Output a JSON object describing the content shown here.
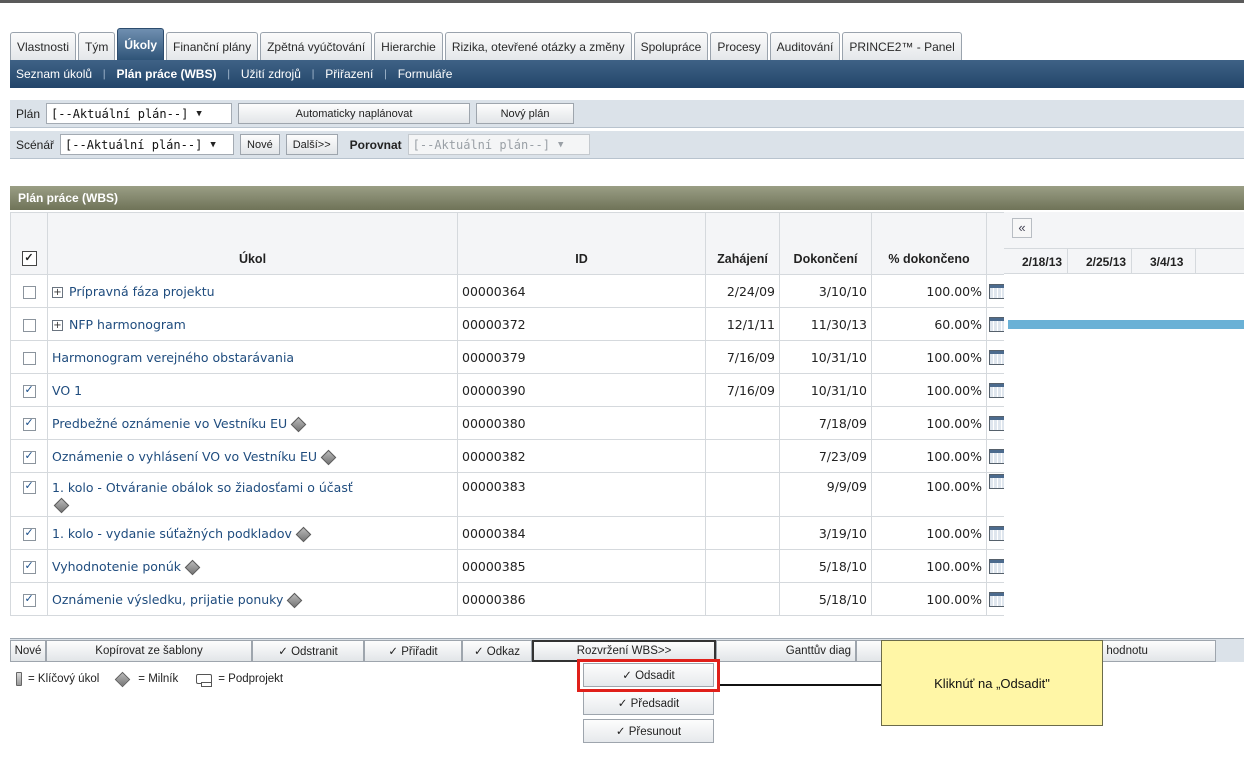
{
  "tabs": [
    "Vlastnosti",
    "Tým",
    "Úkoly",
    "Finanční plány",
    "Zpětná vyúčtování",
    "Hierarchie",
    "Rizika, otevřené otázky a změny",
    "Spolupráce",
    "Procesy",
    "Auditování",
    "PRINCE2™ - Panel"
  ],
  "active_tab": "Úkoly",
  "subnav": [
    "Seznam úkolů",
    "Plán práce (WBS)",
    "Užití zdrojů",
    "Přiřazení",
    "Formuláře"
  ],
  "plan_row": {
    "label": "Plán",
    "select_value": "[--Aktuální plán--]",
    "auto_button": "Automaticky naplánovat",
    "new_plan_button": "Nový plán"
  },
  "scenario_row": {
    "label": "Scénář",
    "select_value": "[--Aktuální plán--]",
    "new_button": "Nové",
    "next_button": "Další>>",
    "compare_label": "Porovnat",
    "compare_value": "[--Aktuální plán--]"
  },
  "panel_title": "Plán práce (WBS)",
  "columns": {
    "task": "Úkol",
    "id": "ID",
    "start": "Zahájení",
    "finish": "Dokončení",
    "percent": "% dokončeno"
  },
  "rows": [
    {
      "checked": false,
      "expandable": true,
      "milestone": false,
      "name": "Prípravná fáza projektu",
      "id": "00000364",
      "start": "2/24/09",
      "finish": "3/10/10",
      "percent": "100.00%"
    },
    {
      "checked": false,
      "expandable": true,
      "milestone": false,
      "name": "NFP harmonogram",
      "id": "00000372",
      "start": "12/1/11",
      "finish": "11/30/13",
      "percent": "60.00%"
    },
    {
      "checked": false,
      "expandable": false,
      "milestone": false,
      "name": "Harmonogram verejného obstarávania",
      "id": "00000379",
      "start": "7/16/09",
      "finish": "10/31/10",
      "percent": "100.00%"
    },
    {
      "checked": true,
      "expandable": false,
      "milestone": false,
      "name": "VO 1",
      "id": "00000390",
      "start": "7/16/09",
      "finish": "10/31/10",
      "percent": "100.00%"
    },
    {
      "checked": true,
      "expandable": false,
      "milestone": true,
      "name": "Predbežné oznámenie vo Vestníku EU",
      "id": "00000380",
      "start": "",
      "finish": "7/18/09",
      "percent": "100.00%"
    },
    {
      "checked": true,
      "expandable": false,
      "milestone": true,
      "name": "Oznámenie o vyhlásení VO vo Vestníku EU",
      "id": "00000382",
      "start": "",
      "finish": "7/23/09",
      "percent": "100.00%"
    },
    {
      "checked": true,
      "expandable": false,
      "milestone": true,
      "name": "1. kolo - Otváranie obálok so žiadosťami o účasť",
      "id": "00000383",
      "start": "",
      "finish": "9/9/09",
      "percent": "100.00%"
    },
    {
      "checked": true,
      "expandable": false,
      "milestone": true,
      "name": "1. kolo - vydanie súťažných podkladov",
      "id": "00000384",
      "start": "",
      "finish": "3/19/10",
      "percent": "100.00%"
    },
    {
      "checked": true,
      "expandable": false,
      "milestone": true,
      "name": "Vyhodnotenie ponúk",
      "id": "00000385",
      "start": "",
      "finish": "5/18/10",
      "percent": "100.00%"
    },
    {
      "checked": true,
      "expandable": false,
      "milestone": true,
      "name": "Oznámenie výsledku, prijatie ponuky",
      "id": "00000386",
      "start": "",
      "finish": "5/18/10",
      "percent": "100.00%"
    }
  ],
  "gantt": {
    "dates": [
      "2/18/13",
      "2/25/13",
      "3/4/13"
    ],
    "nav_icon": "double-chevron-left-icon"
  },
  "actions": {
    "new": "Nové",
    "copy_template": "Kopírovat ze šablony",
    "delete": "✓ Odstranit",
    "assign": "✓ Přiřadit",
    "link": "✓ Odkaz",
    "wbs_layout": "Rozvržení WBS>>",
    "gantt": "Ganttův diag",
    "value_suffix": "nou hodnotu"
  },
  "menu": {
    "indent": "✓ Odsadit",
    "outdent": "✓ Předsadit",
    "move": "✓ Přesunout"
  },
  "legend": {
    "key_task": "= Klíčový úkol",
    "milestone": "= Milník",
    "subproject": "= Podprojekt"
  },
  "callout_text": "Kliknúť na „Odsadit\"",
  "colors": {
    "nav_blue": "#2f5478",
    "panel_olive": "#7d8166",
    "gantt_bar": "#6ab1d6",
    "callout_yellow": "#fff6a6",
    "highlight_red": "#e0201a"
  }
}
